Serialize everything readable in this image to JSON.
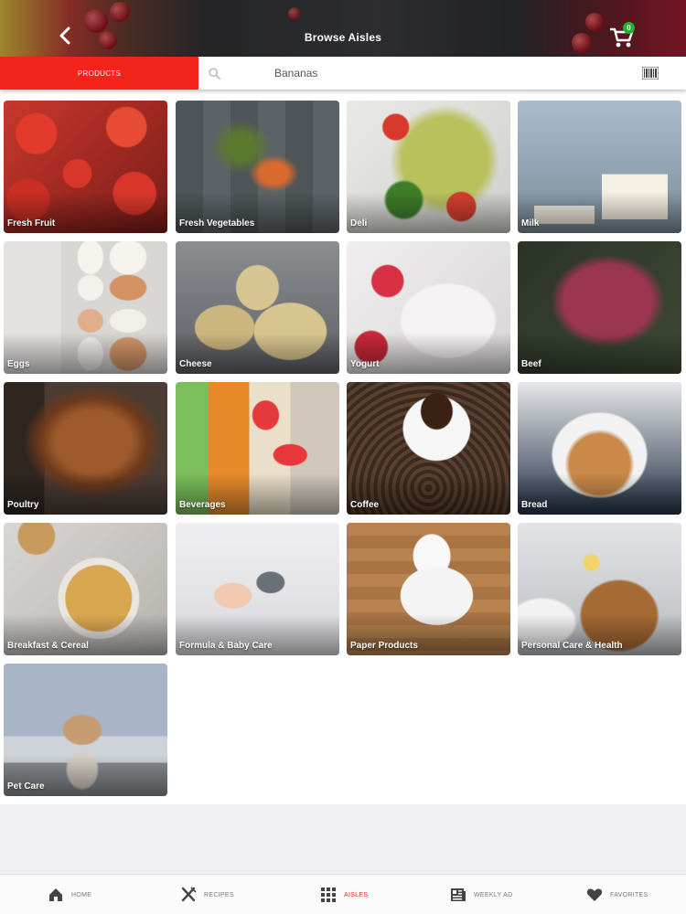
{
  "header": {
    "title": "Browse Aisles",
    "cart_count": "0",
    "back_icon": "chevron-left-icon",
    "cart_icon": "shopping-cart-icon"
  },
  "search": {
    "products_tab_label": "PRODUCTS",
    "value": "Bananas",
    "search_icon": "search-icon",
    "barcode_icon": "barcode-icon"
  },
  "aisles": [
    {
      "label": "Fresh Fruit"
    },
    {
      "label": "Fresh Vegetables"
    },
    {
      "label": "Deli"
    },
    {
      "label": "Milk"
    },
    {
      "label": "Eggs"
    },
    {
      "label": "Cheese"
    },
    {
      "label": "Yogurt"
    },
    {
      "label": "Beef"
    },
    {
      "label": "Poultry"
    },
    {
      "label": "Beverages"
    },
    {
      "label": "Coffee"
    },
    {
      "label": "Bread"
    },
    {
      "label": "Breakfast & Cereal"
    },
    {
      "label": "Formula & Baby Care"
    },
    {
      "label": "Paper Products"
    },
    {
      "label": "Personal Care & Health"
    },
    {
      "label": "Pet Care"
    }
  ],
  "tabbar": {
    "items": [
      {
        "label": "HOME",
        "icon": "home-icon"
      },
      {
        "label": "RECIPES",
        "icon": "fork-knife-icon"
      },
      {
        "label": "AISLES",
        "icon": "grid-icon",
        "active": true
      },
      {
        "label": "WEEKLY AD",
        "icon": "newspaper-icon"
      },
      {
        "label": "FAVORITES",
        "icon": "heart-icon"
      }
    ]
  },
  "colors": {
    "accent": "#f3241a",
    "active_tab": "#e22b1f",
    "badge": "#1fb331"
  }
}
